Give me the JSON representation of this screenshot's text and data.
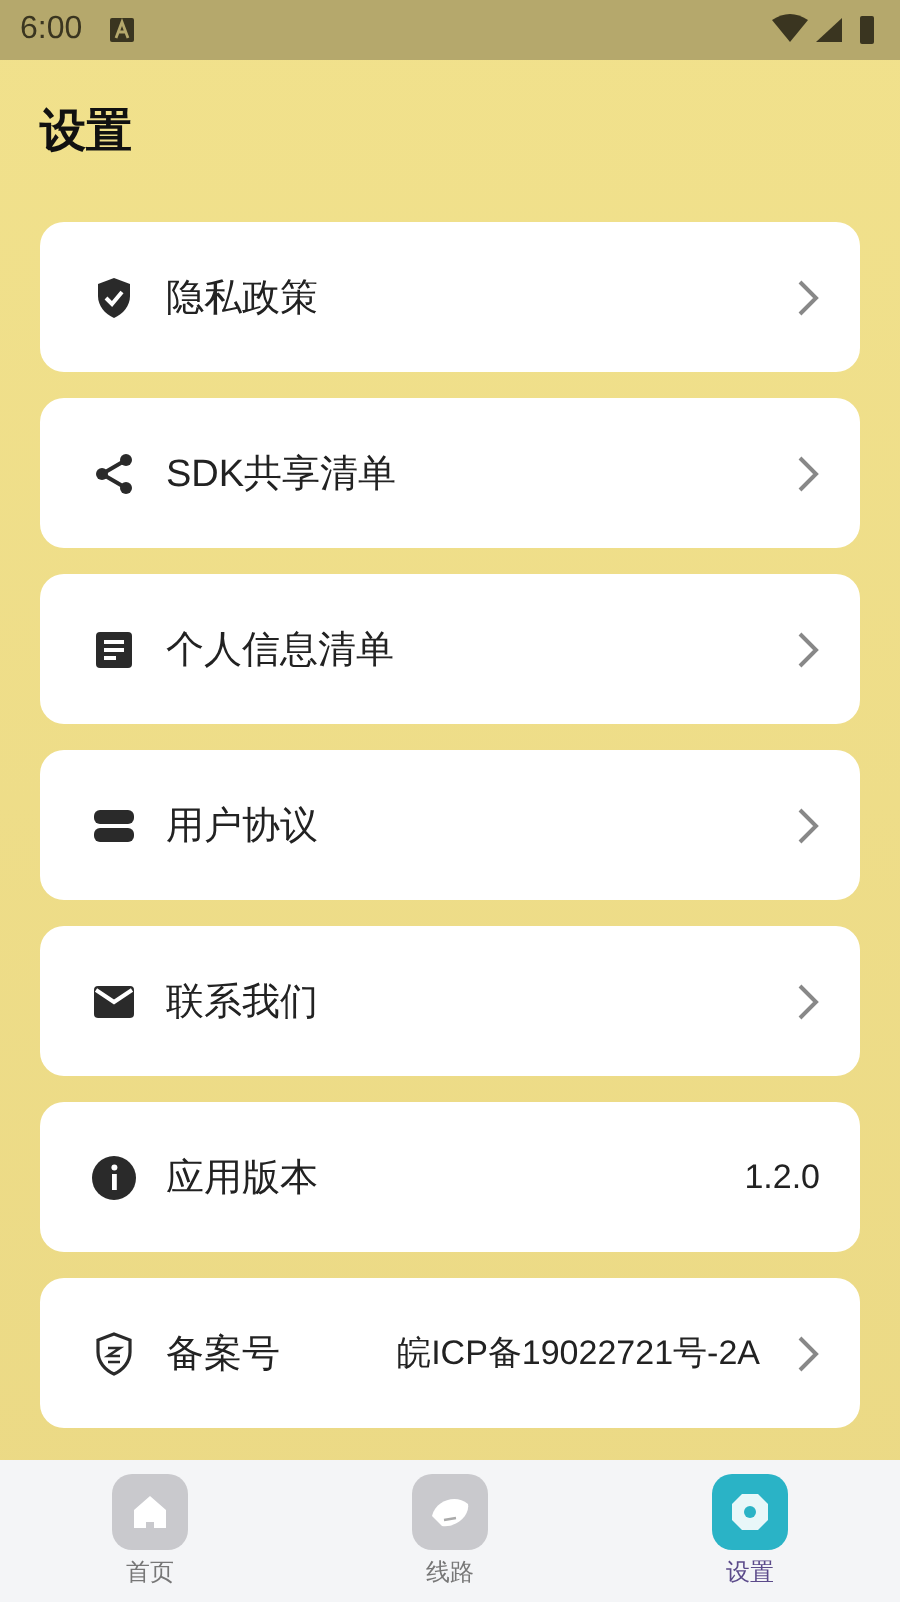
{
  "status_bar": {
    "time": "6:00"
  },
  "title": "设置",
  "items": [
    {
      "kind": "shield",
      "label": "隐私政策",
      "chevron": true
    },
    {
      "kind": "share",
      "label": "SDK共享清单",
      "chevron": true
    },
    {
      "kind": "list",
      "label": "个人信息清单",
      "chevron": true
    },
    {
      "kind": "stack",
      "label": "用户协议",
      "chevron": true
    },
    {
      "kind": "mail",
      "label": "联系我们",
      "chevron": true
    },
    {
      "kind": "info",
      "label": "应用版本",
      "value": "1.2.0",
      "chevron": false
    },
    {
      "kind": "badge",
      "label": "备案号",
      "value": "皖ICP备19022721号-2A",
      "chevron": true
    }
  ],
  "nav": [
    {
      "kind": "home",
      "label": "首页",
      "selected": false
    },
    {
      "kind": "route",
      "label": "线路",
      "selected": false
    },
    {
      "kind": "settings",
      "label": "设置",
      "selected": true
    }
  ]
}
